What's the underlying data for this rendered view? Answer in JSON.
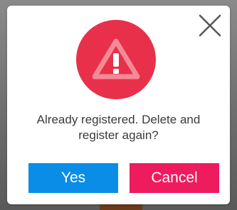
{
  "dialog": {
    "message": "Already registered. Delete and register again?",
    "icon": "warning-triangle-icon",
    "close_icon": "close-icon",
    "yes_label": "Yes",
    "cancel_label": "Cancel",
    "icon_circle_color": "#e8304a",
    "yes_color": "#0a8de6",
    "cancel_color": "#ee1b5f"
  }
}
